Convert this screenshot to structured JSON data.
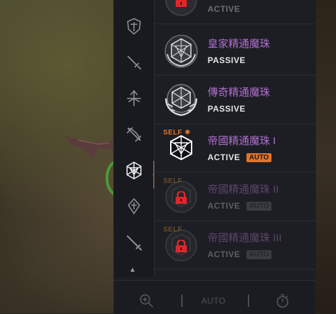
{
  "categories": [
    {
      "icon": "shield-crest-icon",
      "active": false
    },
    {
      "icon": "dagger-icon",
      "active": false
    },
    {
      "icon": "crossed-bow-icon",
      "active": false
    },
    {
      "icon": "crossbow-icon",
      "active": false
    },
    {
      "icon": "d20-crest-icon",
      "active": true
    },
    {
      "icon": "ward-crest-icon",
      "active": false
    },
    {
      "icon": "greatsword-icon",
      "active": false
    }
  ],
  "skills": [
    {
      "name": "",
      "type": "ACTIVE",
      "locked": true,
      "partial": true
    },
    {
      "name": "皇家精通魔珠",
      "type": "PASSIVE"
    },
    {
      "name": "傳奇精通魔珠",
      "type": "PASSIVE"
    },
    {
      "name": "帝國精通魔珠 I",
      "type": "ACTIVE",
      "auto": "AUTO",
      "self": "SELF"
    },
    {
      "name": "帝國精通魔珠 II",
      "type": "ACTIVE",
      "auto": "AUTO",
      "self": "SELF",
      "locked": true
    },
    {
      "name": "帝國精通魔珠 III",
      "type": "ACTIVE",
      "auto": "AUTO",
      "self": "SELF",
      "locked": true
    }
  ],
  "bottom": {
    "auto_label": "AUTO",
    "zoom_icon": "zoom-in-icon",
    "timer_icon": "stopwatch-icon"
  },
  "colors": {
    "accent": "#e2742a",
    "skill_name": "#b06fd0",
    "lock_red": "#e0262b"
  }
}
